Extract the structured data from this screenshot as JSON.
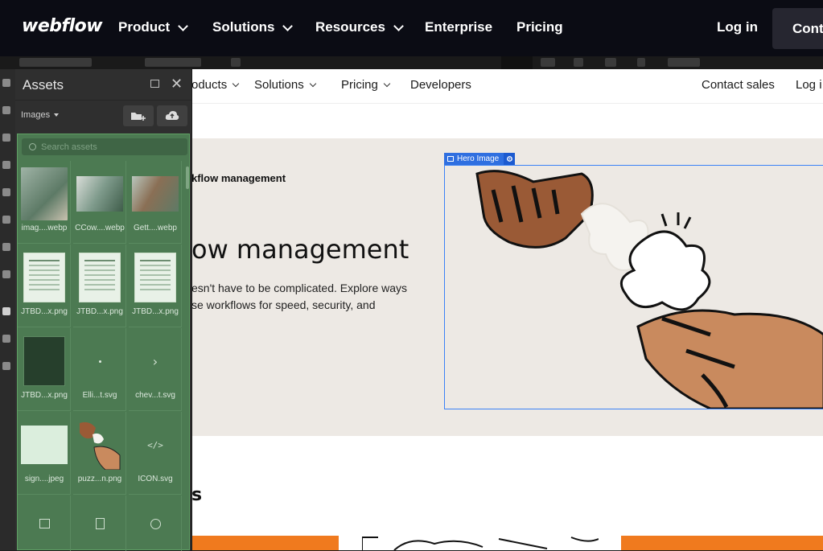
{
  "topnav": {
    "logo": "webflow",
    "items": [
      {
        "label": "Product",
        "dropdown": true
      },
      {
        "label": "Solutions",
        "dropdown": true
      },
      {
        "label": "Resources",
        "dropdown": true
      },
      {
        "label": "Enterprise",
        "dropdown": false
      },
      {
        "label": "Pricing",
        "dropdown": false
      }
    ],
    "login": "Log in",
    "cta": "Cont"
  },
  "site": {
    "nav": {
      "items": [
        "oducts",
        "Solutions",
        "Pricing",
        "Developers"
      ],
      "contact": "Contact sales",
      "login": "Log i"
    },
    "eyebrow": "kflow management",
    "headline": "ow management",
    "desc_line1": "esn't have to be complicated. Explore ways",
    "desc_line2": "se workflows for speed, security, and",
    "hero_tag": "Hero Image",
    "section_letter": "s"
  },
  "assets_panel": {
    "title": "Assets",
    "filter": "Images",
    "search_placeholder": "Search assets",
    "items": [
      {
        "name": "imag....webp",
        "kind": "photo"
      },
      {
        "name": "CCow....webp",
        "kind": "photo2"
      },
      {
        "name": "Gett....webp",
        "kind": "photo2"
      },
      {
        "name": "JTBD...x.png",
        "kind": "doc"
      },
      {
        "name": "JTBD...x.png",
        "kind": "doc"
      },
      {
        "name": "JTBD...x.png",
        "kind": "doc"
      },
      {
        "name": "JTBD...x.png",
        "kind": "darkdoc"
      },
      {
        "name": "Elli...t.svg",
        "kind": "dot"
      },
      {
        "name": "chev...t.svg",
        "kind": "chevron"
      },
      {
        "name": "sign....jpeg",
        "kind": "sign"
      },
      {
        "name": "puzz...n.png",
        "kind": "puzzle"
      },
      {
        "name": "ICON.svg",
        "kind": "code"
      }
    ]
  },
  "colors": {
    "topnav_bg": "#0b0c14",
    "panel_bg": "#2f2f2f",
    "assets_highlight": "#4c7a52",
    "selection_blue": "#2f6fe0",
    "hero_bg": "#ede9e4",
    "orange": "#f07a1e"
  }
}
